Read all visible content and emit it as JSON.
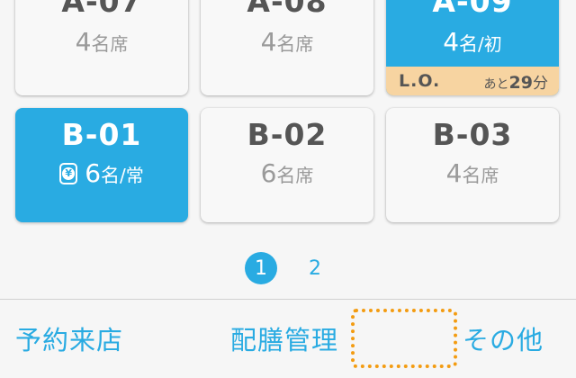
{
  "tables": [
    {
      "id": "a07",
      "name": "A-07",
      "count": "4",
      "unit": "名",
      "suffix": "席",
      "active": false
    },
    {
      "id": "a08",
      "name": "A-08",
      "count": "4",
      "unit": "名",
      "suffix": "席",
      "active": false
    },
    {
      "id": "a09",
      "name": "A-09",
      "count": "4",
      "unit": "名",
      "suffix": "/初",
      "active": true,
      "lo": {
        "label": "L.O.",
        "prefix": "あと",
        "minutes": "29",
        "suffix": "分"
      }
    },
    {
      "id": "b01",
      "name": "B-01",
      "count": "6",
      "unit": "名",
      "suffix": "/常",
      "active": true,
      "icon": "yen-wallet-icon",
      "icon_glyph": "¥"
    },
    {
      "id": "b02",
      "name": "B-02",
      "count": "6",
      "unit": "名",
      "suffix": "席",
      "active": false
    },
    {
      "id": "b03",
      "name": "B-03",
      "count": "4",
      "unit": "名",
      "suffix": "席",
      "active": false
    }
  ],
  "pagination": {
    "current": "1",
    "pages": [
      "1",
      "2"
    ]
  },
  "footer": {
    "reservation": "予約来店",
    "serving": "配膳管理",
    "other": "その他"
  },
  "colors": {
    "accent": "#29abe2",
    "lo_bar": "#f7d4a1",
    "highlight": "#f39c12"
  }
}
